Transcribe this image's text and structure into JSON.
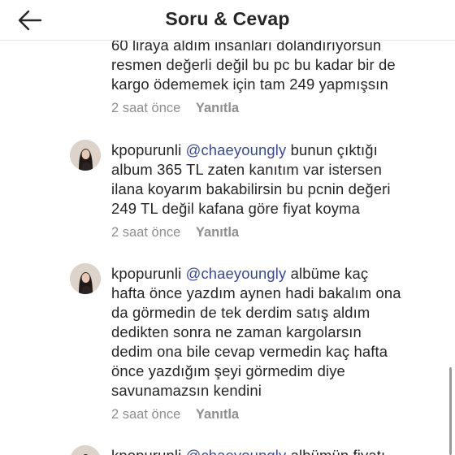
{
  "header": {
    "title": "Soru & Cevap",
    "back_icon": "arrow-left-icon"
  },
  "comments": [
    {
      "lines": [
        "60 liraya aldım insanları dolandırıyorsun",
        "resmen değerli değil bu pc bu kadar bir de",
        "kargo ödememek için tam 249 yapmışsın"
      ],
      "time": "2 saat önce",
      "reply": "Yanıtla"
    },
    {
      "username": "kpopurunli",
      "mention": "@chaeyoungly",
      "first_line_text": "bunun çıktığı",
      "lines": [
        "album 365 TL zaten kanıtım var istersen",
        "ilana koyarım bakabilirsin bu pcnin değeri",
        "249 TL değil kafana göre fiyat koyma"
      ],
      "time": "2 saat önce",
      "reply": "Yanıtla"
    },
    {
      "username": "kpopurunli",
      "mention": "@chaeyoungly",
      "first_line_text": "albüme kaç",
      "lines": [
        "hafta önce yazdım aynen hadi bakalım ona",
        "da görmedin de tek derdim satış aldım",
        "dedikten sonra ne zaman kargolarsın",
        "dedim ona bile cevap vermedin kaç hafta",
        "önce yazdığım şeyi görmedim diye",
        "savunamazsın kendini"
      ],
      "time": "2 saat önce",
      "reply": "Yanıtla"
    },
    {
      "username": "kpopurunli",
      "mention": "@chaeyoungly",
      "first_line_text": "albümün fiyatı"
    }
  ],
  "colors": {
    "text": "#262626",
    "mention": "#3b4a8f",
    "meta": "#8e8e8e"
  }
}
